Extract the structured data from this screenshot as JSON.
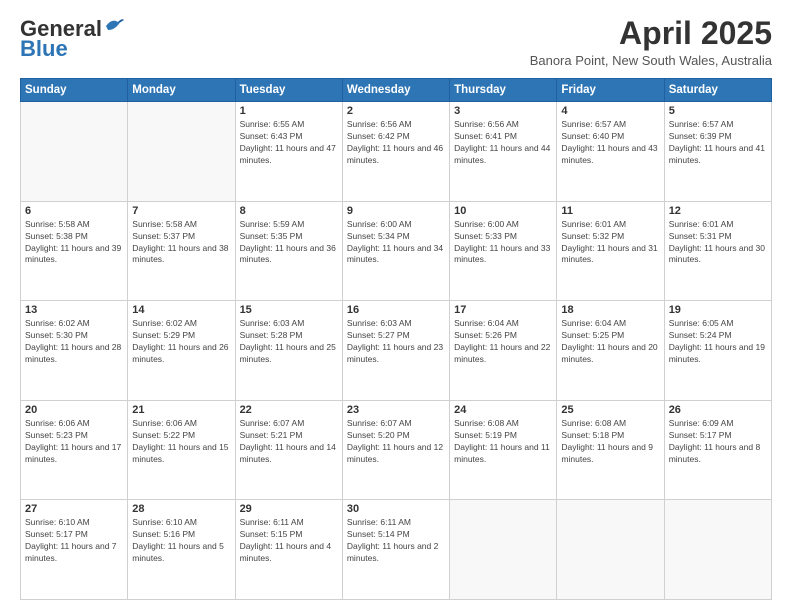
{
  "header": {
    "logo_general": "General",
    "logo_blue": "Blue",
    "month": "April 2025",
    "location": "Banora Point, New South Wales, Australia"
  },
  "weekdays": [
    "Sunday",
    "Monday",
    "Tuesday",
    "Wednesday",
    "Thursday",
    "Friday",
    "Saturday"
  ],
  "weeks": [
    [
      {
        "day": "",
        "info": ""
      },
      {
        "day": "",
        "info": ""
      },
      {
        "day": "1",
        "info": "Sunrise: 6:55 AM\nSunset: 6:43 PM\nDaylight: 11 hours and 47 minutes."
      },
      {
        "day": "2",
        "info": "Sunrise: 6:56 AM\nSunset: 6:42 PM\nDaylight: 11 hours and 46 minutes."
      },
      {
        "day": "3",
        "info": "Sunrise: 6:56 AM\nSunset: 6:41 PM\nDaylight: 11 hours and 44 minutes."
      },
      {
        "day": "4",
        "info": "Sunrise: 6:57 AM\nSunset: 6:40 PM\nDaylight: 11 hours and 43 minutes."
      },
      {
        "day": "5",
        "info": "Sunrise: 6:57 AM\nSunset: 6:39 PM\nDaylight: 11 hours and 41 minutes."
      }
    ],
    [
      {
        "day": "6",
        "info": "Sunrise: 5:58 AM\nSunset: 5:38 PM\nDaylight: 11 hours and 39 minutes."
      },
      {
        "day": "7",
        "info": "Sunrise: 5:58 AM\nSunset: 5:37 PM\nDaylight: 11 hours and 38 minutes."
      },
      {
        "day": "8",
        "info": "Sunrise: 5:59 AM\nSunset: 5:35 PM\nDaylight: 11 hours and 36 minutes."
      },
      {
        "day": "9",
        "info": "Sunrise: 6:00 AM\nSunset: 5:34 PM\nDaylight: 11 hours and 34 minutes."
      },
      {
        "day": "10",
        "info": "Sunrise: 6:00 AM\nSunset: 5:33 PM\nDaylight: 11 hours and 33 minutes."
      },
      {
        "day": "11",
        "info": "Sunrise: 6:01 AM\nSunset: 5:32 PM\nDaylight: 11 hours and 31 minutes."
      },
      {
        "day": "12",
        "info": "Sunrise: 6:01 AM\nSunset: 5:31 PM\nDaylight: 11 hours and 30 minutes."
      }
    ],
    [
      {
        "day": "13",
        "info": "Sunrise: 6:02 AM\nSunset: 5:30 PM\nDaylight: 11 hours and 28 minutes."
      },
      {
        "day": "14",
        "info": "Sunrise: 6:02 AM\nSunset: 5:29 PM\nDaylight: 11 hours and 26 minutes."
      },
      {
        "day": "15",
        "info": "Sunrise: 6:03 AM\nSunset: 5:28 PM\nDaylight: 11 hours and 25 minutes."
      },
      {
        "day": "16",
        "info": "Sunrise: 6:03 AM\nSunset: 5:27 PM\nDaylight: 11 hours and 23 minutes."
      },
      {
        "day": "17",
        "info": "Sunrise: 6:04 AM\nSunset: 5:26 PM\nDaylight: 11 hours and 22 minutes."
      },
      {
        "day": "18",
        "info": "Sunrise: 6:04 AM\nSunset: 5:25 PM\nDaylight: 11 hours and 20 minutes."
      },
      {
        "day": "19",
        "info": "Sunrise: 6:05 AM\nSunset: 5:24 PM\nDaylight: 11 hours and 19 minutes."
      }
    ],
    [
      {
        "day": "20",
        "info": "Sunrise: 6:06 AM\nSunset: 5:23 PM\nDaylight: 11 hours and 17 minutes."
      },
      {
        "day": "21",
        "info": "Sunrise: 6:06 AM\nSunset: 5:22 PM\nDaylight: 11 hours and 15 minutes."
      },
      {
        "day": "22",
        "info": "Sunrise: 6:07 AM\nSunset: 5:21 PM\nDaylight: 11 hours and 14 minutes."
      },
      {
        "day": "23",
        "info": "Sunrise: 6:07 AM\nSunset: 5:20 PM\nDaylight: 11 hours and 12 minutes."
      },
      {
        "day": "24",
        "info": "Sunrise: 6:08 AM\nSunset: 5:19 PM\nDaylight: 11 hours and 11 minutes."
      },
      {
        "day": "25",
        "info": "Sunrise: 6:08 AM\nSunset: 5:18 PM\nDaylight: 11 hours and 9 minutes."
      },
      {
        "day": "26",
        "info": "Sunrise: 6:09 AM\nSunset: 5:17 PM\nDaylight: 11 hours and 8 minutes."
      }
    ],
    [
      {
        "day": "27",
        "info": "Sunrise: 6:10 AM\nSunset: 5:17 PM\nDaylight: 11 hours and 7 minutes."
      },
      {
        "day": "28",
        "info": "Sunrise: 6:10 AM\nSunset: 5:16 PM\nDaylight: 11 hours and 5 minutes."
      },
      {
        "day": "29",
        "info": "Sunrise: 6:11 AM\nSunset: 5:15 PM\nDaylight: 11 hours and 4 minutes."
      },
      {
        "day": "30",
        "info": "Sunrise: 6:11 AM\nSunset: 5:14 PM\nDaylight: 11 hours and 2 minutes."
      },
      {
        "day": "",
        "info": ""
      },
      {
        "day": "",
        "info": ""
      },
      {
        "day": "",
        "info": ""
      }
    ]
  ]
}
